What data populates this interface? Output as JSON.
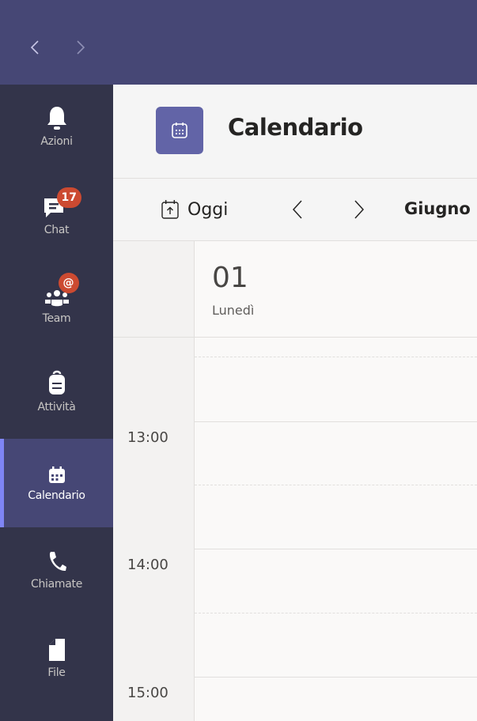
{
  "topbar": {
    "back_icon": "chevron-left-icon",
    "forward_icon": "chevron-right-icon"
  },
  "rail": {
    "items": [
      {
        "label": "Azioni",
        "icon": "bell-icon"
      },
      {
        "label": "Chat",
        "icon": "chat-icon",
        "badge": "17"
      },
      {
        "label": "Team",
        "icon": "team-icon",
        "badge": "@"
      },
      {
        "label": "Attività",
        "icon": "backpack-icon"
      },
      {
        "label": "Calendario",
        "icon": "calendar-icon",
        "active": true
      },
      {
        "label": "Chiamate",
        "icon": "phone-icon"
      },
      {
        "label": "File",
        "icon": "file-icon"
      }
    ]
  },
  "header": {
    "title": "Calendario",
    "icon": "calendar-icon"
  },
  "toolbar": {
    "today_label": "Oggi",
    "today_icon": "calendar-today-icon",
    "prev_icon": "chevron-left-icon",
    "next_icon": "chevron-right-icon",
    "month_label": "Giugno"
  },
  "calendar": {
    "day_number": "01",
    "day_name": "Lunedì",
    "time_labels": [
      "13:00",
      "14:00",
      "15:00"
    ]
  },
  "colors": {
    "topbar": "#464775",
    "rail": "#33344a",
    "accent": "#6264a7",
    "badge": "#cc4a31"
  }
}
